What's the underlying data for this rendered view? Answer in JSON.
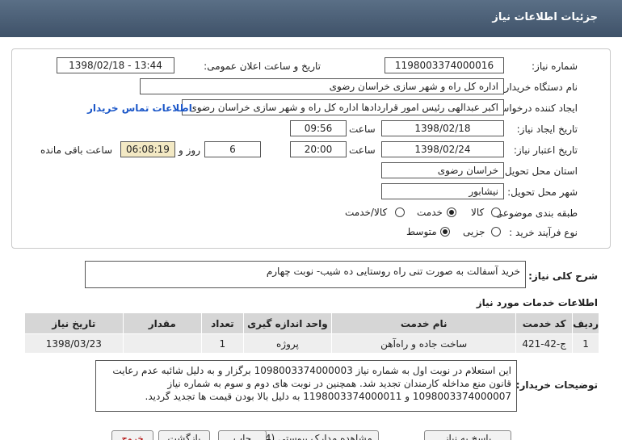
{
  "header": {
    "title": "جزئیات اطلاعات نیاز"
  },
  "form": {
    "need_number_label": "شماره نیاز:",
    "need_number": "1198003374000016",
    "announce_label": "تاریخ و ساعت اعلان عمومی:",
    "announce_value": "1398/02/18 - 13:44",
    "buyer_label": "نام دستگاه خریدار:",
    "buyer": "اداره کل راه و شهر سازی خراسان رضوی",
    "requester_label": "ایجاد کننده درخواست:",
    "requester": "اکبر عبدالهی رئیس امور قراردادها اداره کل راه و شهر سازی خراسان رضوی",
    "contact_link": "اطلاعات تماس خریدار",
    "created_label": "تاریخ ایجاد نیاز:",
    "created_date": "1398/02/18",
    "time_label": "ساعت",
    "created_time": "09:56",
    "validity_label": "تاریخ اعتبار نیاز:",
    "validity_date": "1398/02/24",
    "validity_time": "20:00",
    "days": "6",
    "days_label": "روز و",
    "remaining": "06:08:19",
    "remaining_label": "ساعت باقی مانده",
    "province_label": "استان محل تحویل:",
    "province": "خراسان رضوی",
    "city_label": "شهر محل تحویل:",
    "city": "نیشابور",
    "category_label": "طبقه بندی موضوعی:",
    "category_options": [
      "کالا",
      "خدمت",
      "کالا/خدمت"
    ],
    "category_selected": 1,
    "process_label": "نوع فرآیند خرید :",
    "process_options": [
      "جزیی",
      "متوسط"
    ],
    "process_selected": 1
  },
  "summary": {
    "label": "شرح کلی نیاز:",
    "text": "خرید آسفالت به صورت تنی راه روستایی ده شیب- نوبت چهارم"
  },
  "services": {
    "title": "اطلاعات خدمات مورد نیاز",
    "columns": [
      "ردیف",
      "کد خدمت",
      "نام خدمت",
      "واحد اندازه گیری",
      "تعداد",
      "مقدار",
      "تاریخ نیاز"
    ],
    "rows": [
      [
        "1",
        "ج-42-421",
        "ساخت جاده و راه‌آهن",
        "پروژه",
        "1",
        "",
        "1398/03/23"
      ]
    ]
  },
  "notes": {
    "label": "توضیحات خریدار:",
    "text": "این استعلام در نوبت اول به شماره نیاز 1098003374000003 برگزار و به دلیل شائبه عدم رعایت قانون منع مداخله کارمندان تجدید شد. همچنین در نوبت های دوم و سوم به شماره نیاز 1098003374000007 و 1198003374000011 به دلیل بالا بودن قیمت ها تجدید گردید."
  },
  "footer": {
    "buttons": [
      "پاسخ به نیاز",
      "مشاهده مدارک پیوستی (4)",
      "چاپ",
      "بازگشت",
      "خروج"
    ]
  }
}
